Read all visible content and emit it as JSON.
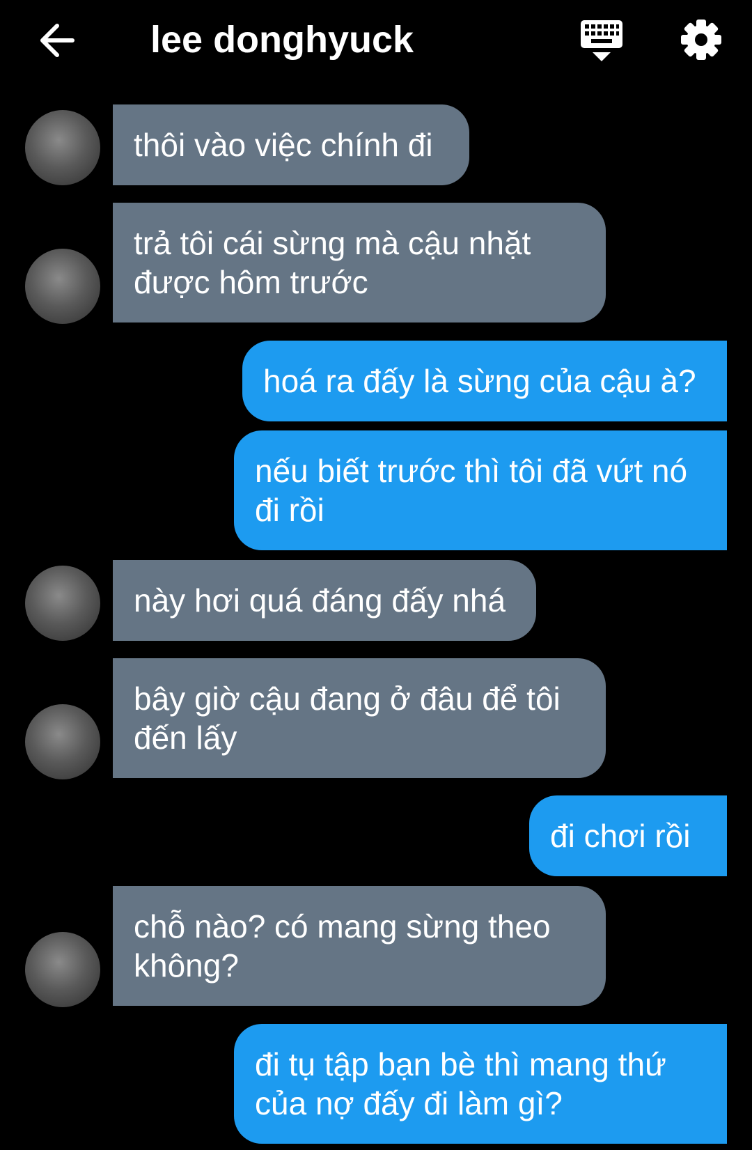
{
  "header": {
    "title": "lee donghyuck",
    "back_icon": "arrow-left-icon",
    "keyboard_icon": "keyboard-icon",
    "settings_icon": "gear-icon"
  },
  "colors": {
    "background": "#000000",
    "incoming_bubble": "#657585",
    "outgoing_bubble": "#1d9bf0",
    "text": "#ffffff"
  },
  "messages": [
    {
      "side": "in",
      "lines": [
        "thôi vào việc chính đi"
      ]
    },
    {
      "side": "in",
      "lines": [
        "trả tôi cái sừng mà cậu nhặt",
        "được hôm trước"
      ]
    },
    {
      "side": "out",
      "lines": [
        "hoá ra đấy là sừng của cậu à?"
      ]
    },
    {
      "side": "out",
      "lines": [
        "nếu biết trước thì tôi đã vứt nó",
        "đi rồi"
      ]
    },
    {
      "side": "in",
      "lines": [
        "này hơi quá đáng đấy nhá"
      ]
    },
    {
      "side": "in",
      "lines": [
        "bây giờ cậu đang ở đâu để tôi",
        "đến lấy"
      ]
    },
    {
      "side": "out",
      "lines": [
        "đi chơi rồi"
      ]
    },
    {
      "side": "in",
      "lines": [
        "chỗ nào? có mang sừng theo",
        "không?"
      ]
    },
    {
      "side": "out",
      "lines": [
        "đi tụ tập bạn bè thì mang thứ",
        "của nợ đấy đi làm gì?"
      ]
    }
  ]
}
